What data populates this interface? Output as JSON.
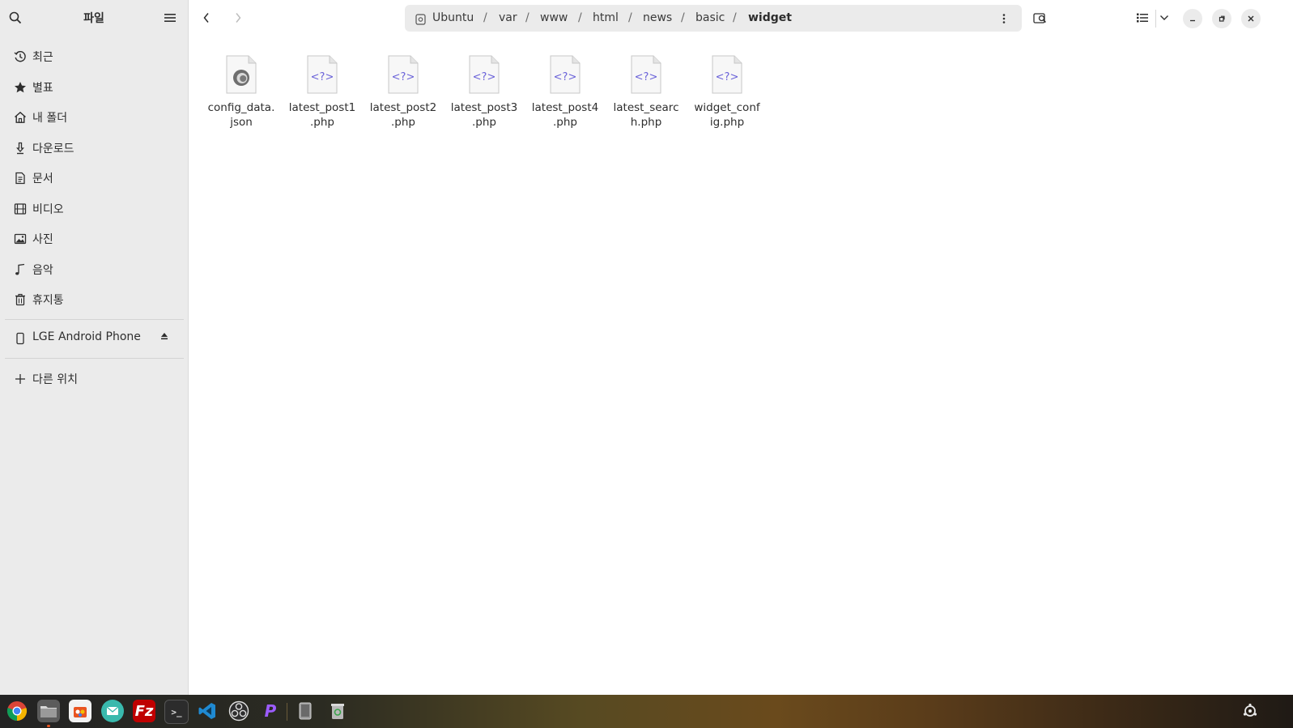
{
  "sidebar": {
    "title": "파일",
    "places": [
      {
        "label": "최근",
        "icon": "clock-icon"
      },
      {
        "label": "별표",
        "icon": "star-icon"
      },
      {
        "label": "내 폴더",
        "icon": "home-icon"
      },
      {
        "label": "다운로드",
        "icon": "download-icon"
      },
      {
        "label": "문서",
        "icon": "document-icon"
      },
      {
        "label": "비디오",
        "icon": "film-icon"
      },
      {
        "label": "사진",
        "icon": "image-icon"
      },
      {
        "label": "음악",
        "icon": "music-icon"
      },
      {
        "label": "휴지통",
        "icon": "trash-icon"
      }
    ],
    "device": {
      "label": "LGE Android Phone",
      "icon": "phone-icon",
      "eject_icon": "eject-icon"
    },
    "other_locations": {
      "label": "다른 위치",
      "icon": "plus-icon"
    }
  },
  "path": {
    "root": "Ubuntu",
    "segments": [
      "var",
      "www",
      "html",
      "news",
      "basic"
    ],
    "current": "widget"
  },
  "files": [
    {
      "name": "config_data.json",
      "line1": "config_data.",
      "line2": "json",
      "type": "json"
    },
    {
      "name": "latest_post1.php",
      "line1": "latest_post1",
      "line2": ".php",
      "type": "php"
    },
    {
      "name": "latest_post2.php",
      "line1": "latest_post2",
      "line2": ".php",
      "type": "php"
    },
    {
      "name": "latest_post3.php",
      "line1": "latest_post3",
      "line2": ".php",
      "type": "php"
    },
    {
      "name": "latest_post4.php",
      "line1": "latest_post4",
      "line2": ".php",
      "type": "php"
    },
    {
      "name": "latest_search.php",
      "line1": "latest_searc",
      "line2": "h.php",
      "type": "php"
    },
    {
      "name": "widget_config.php",
      "line1": "widget_conf",
      "line2": "ig.php",
      "type": "php"
    }
  ],
  "php_glyph": "<?>",
  "taskbar": {
    "apps": [
      "chrome",
      "files",
      "software",
      "mail",
      "filezilla",
      "terminal",
      "vscode",
      "obs",
      "phpstorm",
      "device",
      "trash"
    ]
  },
  "colors": {
    "sidebar_bg": "#ebebeb",
    "accent": "#e95420",
    "php_glyph": "#6b63d9"
  }
}
